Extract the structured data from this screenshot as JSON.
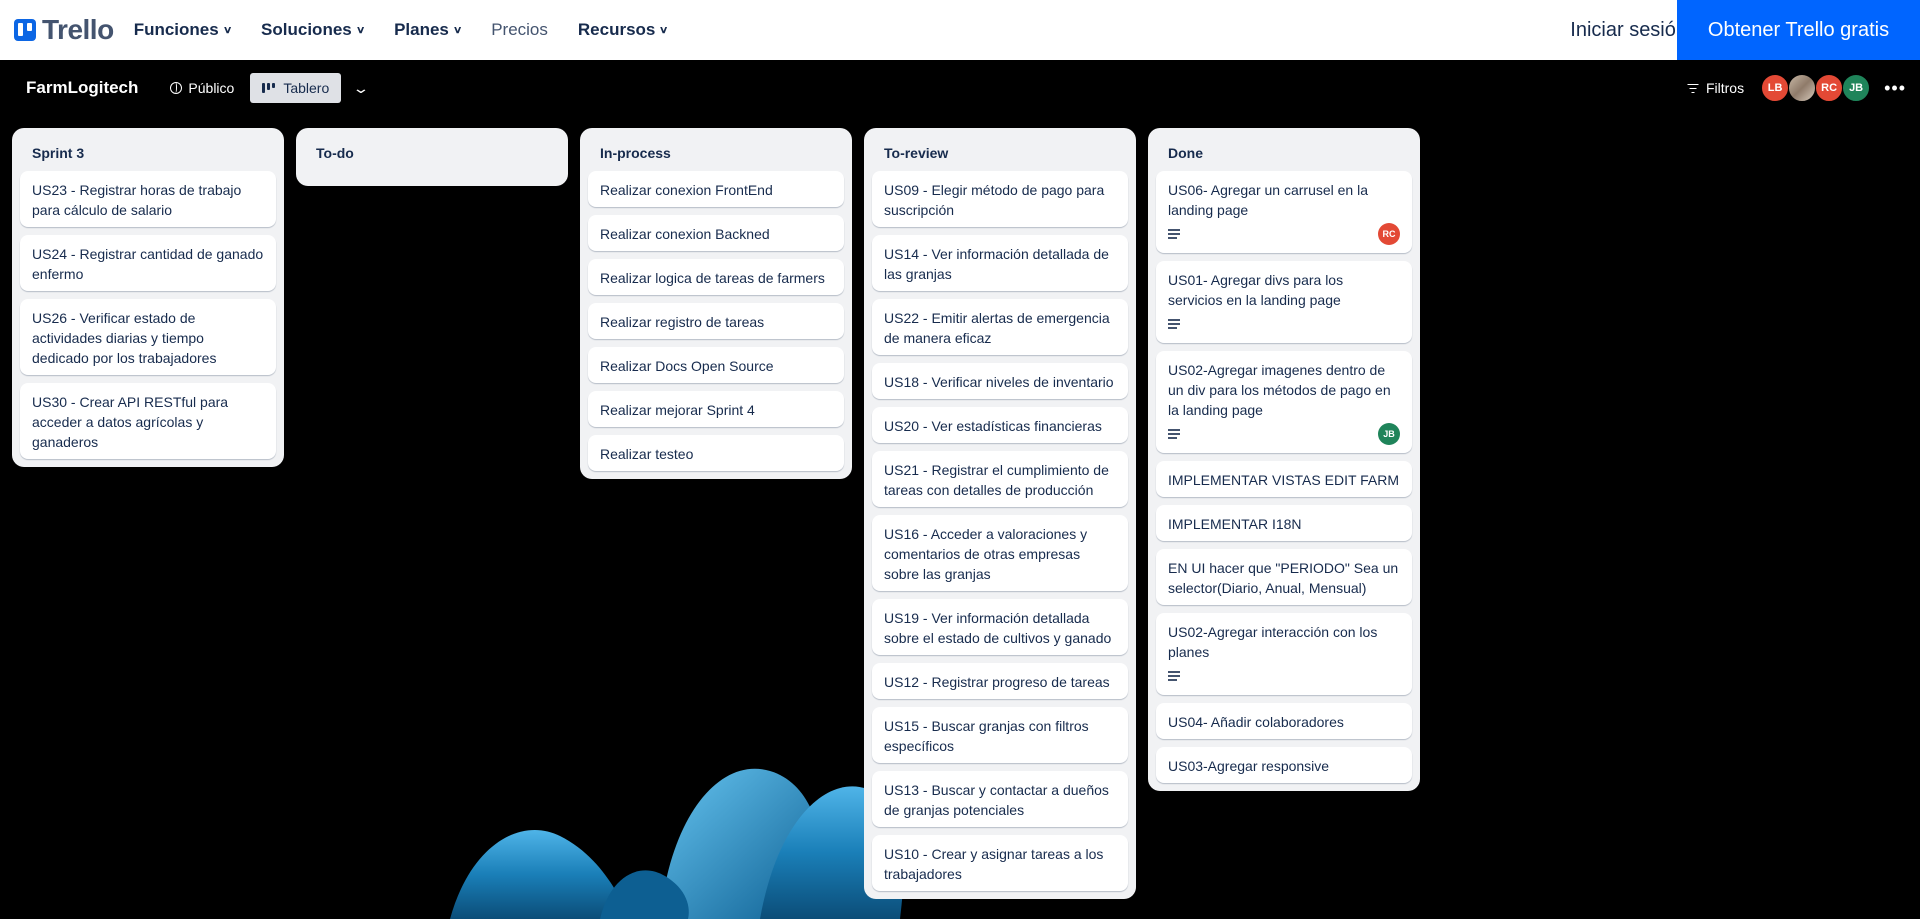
{
  "topnav": {
    "logo": "Trello",
    "links": [
      {
        "label": "Funciones",
        "dropdown": true
      },
      {
        "label": "Soluciones",
        "dropdown": true
      },
      {
        "label": "Planes",
        "dropdown": true
      },
      {
        "label": "Precios",
        "dropdown": false
      },
      {
        "label": "Recursos",
        "dropdown": true
      }
    ],
    "login": "Iniciar sesión",
    "cta": "Obtener Trello gratis"
  },
  "board": {
    "name": "FarmLogitech",
    "visibility": "Público",
    "view": "Tablero",
    "filters": "Filtros",
    "members": [
      {
        "initials": "LB",
        "color": "#e34935"
      },
      {
        "initials": "",
        "color": "photo"
      },
      {
        "initials": "RC",
        "color": "#e34935"
      },
      {
        "initials": "JB",
        "color": "#1f845a"
      }
    ]
  },
  "lists": [
    {
      "title": "Sprint 3",
      "cards": [
        {
          "text": "US23 - Registrar horas de trabajo para cálculo de salario"
        },
        {
          "text": "US24 - Registrar cantidad de ganado enfermo"
        },
        {
          "text": "US26 - Verificar estado de actividades diarias y tiempo dedicado por los trabajadores"
        },
        {
          "text": "US30 - Crear API RESTful para acceder a datos agrícolas y ganaderos"
        }
      ]
    },
    {
      "title": "To-do",
      "cards": []
    },
    {
      "title": "In-process",
      "cards": [
        {
          "text": "Realizar conexion FrontEnd"
        },
        {
          "text": "Realizar conexion Backned"
        },
        {
          "text": "Realizar logica de tareas de farmers"
        },
        {
          "text": "Realizar registro de tareas"
        },
        {
          "text": "Realizar Docs Open Source"
        },
        {
          "text": "Realizar mejorar Sprint 4"
        },
        {
          "text": "Realizar testeo"
        }
      ]
    },
    {
      "title": "To-review",
      "cards": [
        {
          "text": "US09 - Elegir método de pago para suscripción"
        },
        {
          "text": "US14 - Ver información detallada de las granjas"
        },
        {
          "text": "US22 - Emitir alertas de emergencia de manera eficaz"
        },
        {
          "text": "US18 - Verificar niveles de inventario"
        },
        {
          "text": "US20 - Ver estadísticas financieras"
        },
        {
          "text": "US21 - Registrar el cumplimiento de tareas con detalles de producción"
        },
        {
          "text": "US16 - Acceder a valoraciones y comentarios de otras empresas sobre las granjas"
        },
        {
          "text": "US19 - Ver información detallada sobre el estado de cultivos y ganado"
        },
        {
          "text": "US12 - Registrar progreso de tareas"
        },
        {
          "text": "US15 - Buscar granjas con filtros específicos"
        },
        {
          "text": "US13 - Buscar y contactar a dueños de granjas potenciales"
        },
        {
          "text": "US10 - Crear y asignar tareas a los trabajadores"
        }
      ]
    },
    {
      "title": "Done",
      "cards": [
        {
          "text": "US06- Agregar un carrusel en la landing page",
          "description": true,
          "member": "RC",
          "member_color": "#e34935"
        },
        {
          "text": "US01- Agregar divs para los servicios en la landing page",
          "description": true
        },
        {
          "text": "US02-Agregar imagenes dentro de un div para los métodos de pago en la landing page",
          "description": true,
          "member": "JB",
          "member_color": "#1f845a"
        },
        {
          "text": "IMPLEMENTAR VISTAS EDIT FARM"
        },
        {
          "text": "IMPLEMENTAR I18N"
        },
        {
          "text": "EN UI hacer que \"PERIODO\" Sea un selector(Diario, Anual, Mensual)"
        },
        {
          "text": "US02-Agregar interacción con los planes",
          "description": true
        },
        {
          "text": "US04- Añadir colaboradores"
        },
        {
          "text": "US03-Agregar responsive"
        }
      ]
    }
  ]
}
